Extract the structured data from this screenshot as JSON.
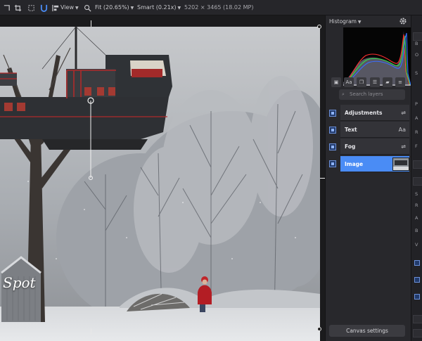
{
  "toolbar": {
    "view_menu": "View",
    "zoom_menu": "Fit (20.65%)",
    "quality_menu": "Smart (0.21x)",
    "image_info": "5202 × 3465 (18.02 MP)",
    "icons": [
      "crop-icon",
      "transform-icon",
      "magnet-icon",
      "align-icon",
      "zoom-icon"
    ]
  },
  "panel": {
    "histogram_label": "Histogram",
    "layer_search_placeholder": "Search layers",
    "layers": [
      {
        "name": "Adjustments",
        "icon": "sliders-icon",
        "selected": false
      },
      {
        "name": "Text",
        "icon": "text-icon",
        "selected": false
      },
      {
        "name": "Fog",
        "icon": "sliders-icon",
        "selected": false
      },
      {
        "name": "Image",
        "icon": "thumbnail",
        "selected": true
      }
    ],
    "canvas_settings_label": "Canvas settings",
    "tool_icons": [
      "image-icon",
      "text-layer-icon",
      "copy-icon",
      "adjust-icon",
      "folder-icon",
      "menu-icon"
    ],
    "text_icon_glyph": "Aa",
    "search_glyph": "⌕"
  },
  "photo": {
    "watermark": "Spot"
  },
  "strip": {
    "letters": [
      "B",
      "O",
      "S",
      "P",
      "A",
      "R",
      "F",
      "S",
      "R",
      "A",
      "B",
      "V"
    ]
  },
  "colors": {
    "accent": "#4a8cf5",
    "panel_bg": "#28282c",
    "canvas_bg": "#1b1b1d",
    "toolbar_bg": "#26262a"
  }
}
